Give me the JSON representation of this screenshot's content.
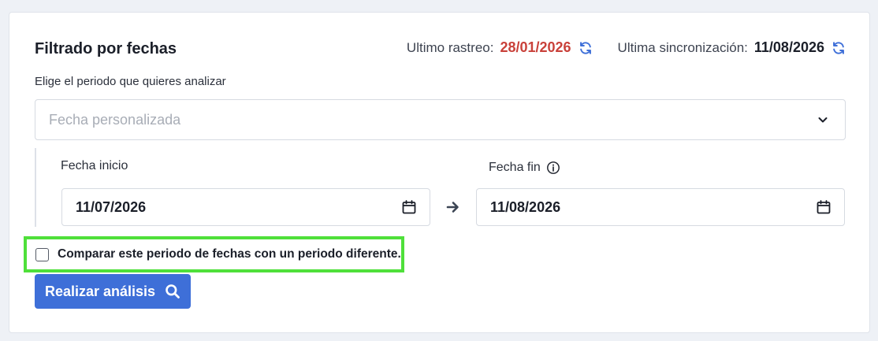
{
  "header": {
    "title": "Filtrado por fechas",
    "last_crawl_label": "Ultimo rastreo:",
    "last_crawl_value": "28/01/2026",
    "last_sync_label": "Ultima sincronización:",
    "last_sync_value": "11/08/2026"
  },
  "period": {
    "prompt": "Elige el periodo que quieres analizar",
    "select_placeholder": "Fecha personalizada"
  },
  "dates": {
    "start_label": "Fecha inicio",
    "start_value": "11/07/2026",
    "end_label": "Fecha fin",
    "end_value": "11/08/2026"
  },
  "compare": {
    "label": "Comparar este periodo de fechas con un periodo diferente.",
    "checked": false
  },
  "action": {
    "button_label": "Realizar análisis"
  },
  "colors": {
    "accent": "#3e6fd8",
    "crawl_date": "#c9413a",
    "highlight": "#4fe03a"
  },
  "icons": [
    "refresh-icon",
    "chevron-down-icon",
    "info-icon",
    "calendar-icon",
    "arrow-right-icon",
    "search-icon"
  ]
}
